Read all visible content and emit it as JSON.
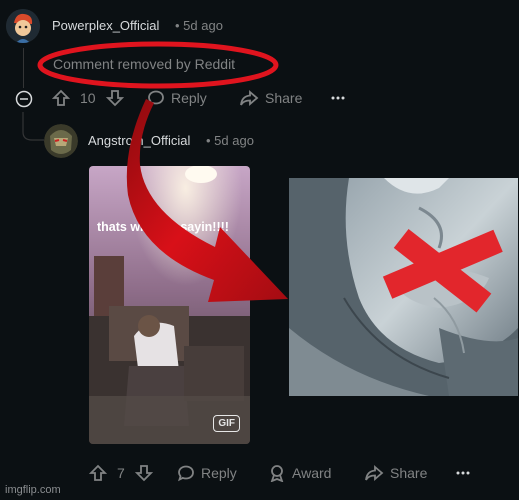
{
  "post": {
    "author": "Powerplex_Official",
    "age": "• 5d ago",
    "body": "Comment removed by Reddit",
    "votes": "10",
    "reply": "Reply",
    "share": "Share"
  },
  "reply": {
    "author": "Angstrom_Official",
    "age": "• 5d ago",
    "gif_caption": "thats what im sayin!!!!",
    "gif_badge": "GIF",
    "votes": "7",
    "reply": "Reply",
    "award": "Award",
    "share": "Share"
  },
  "meme": {
    "circle_color": "#e0141e",
    "arrow_color": "#d81018",
    "tape_color": "#e2262c"
  },
  "watermark": "imgflip.com",
  "icons": [
    "collapse-icon",
    "upvote-icon",
    "downvote-icon",
    "comment-icon",
    "share-icon",
    "more-icon",
    "award-icon"
  ]
}
